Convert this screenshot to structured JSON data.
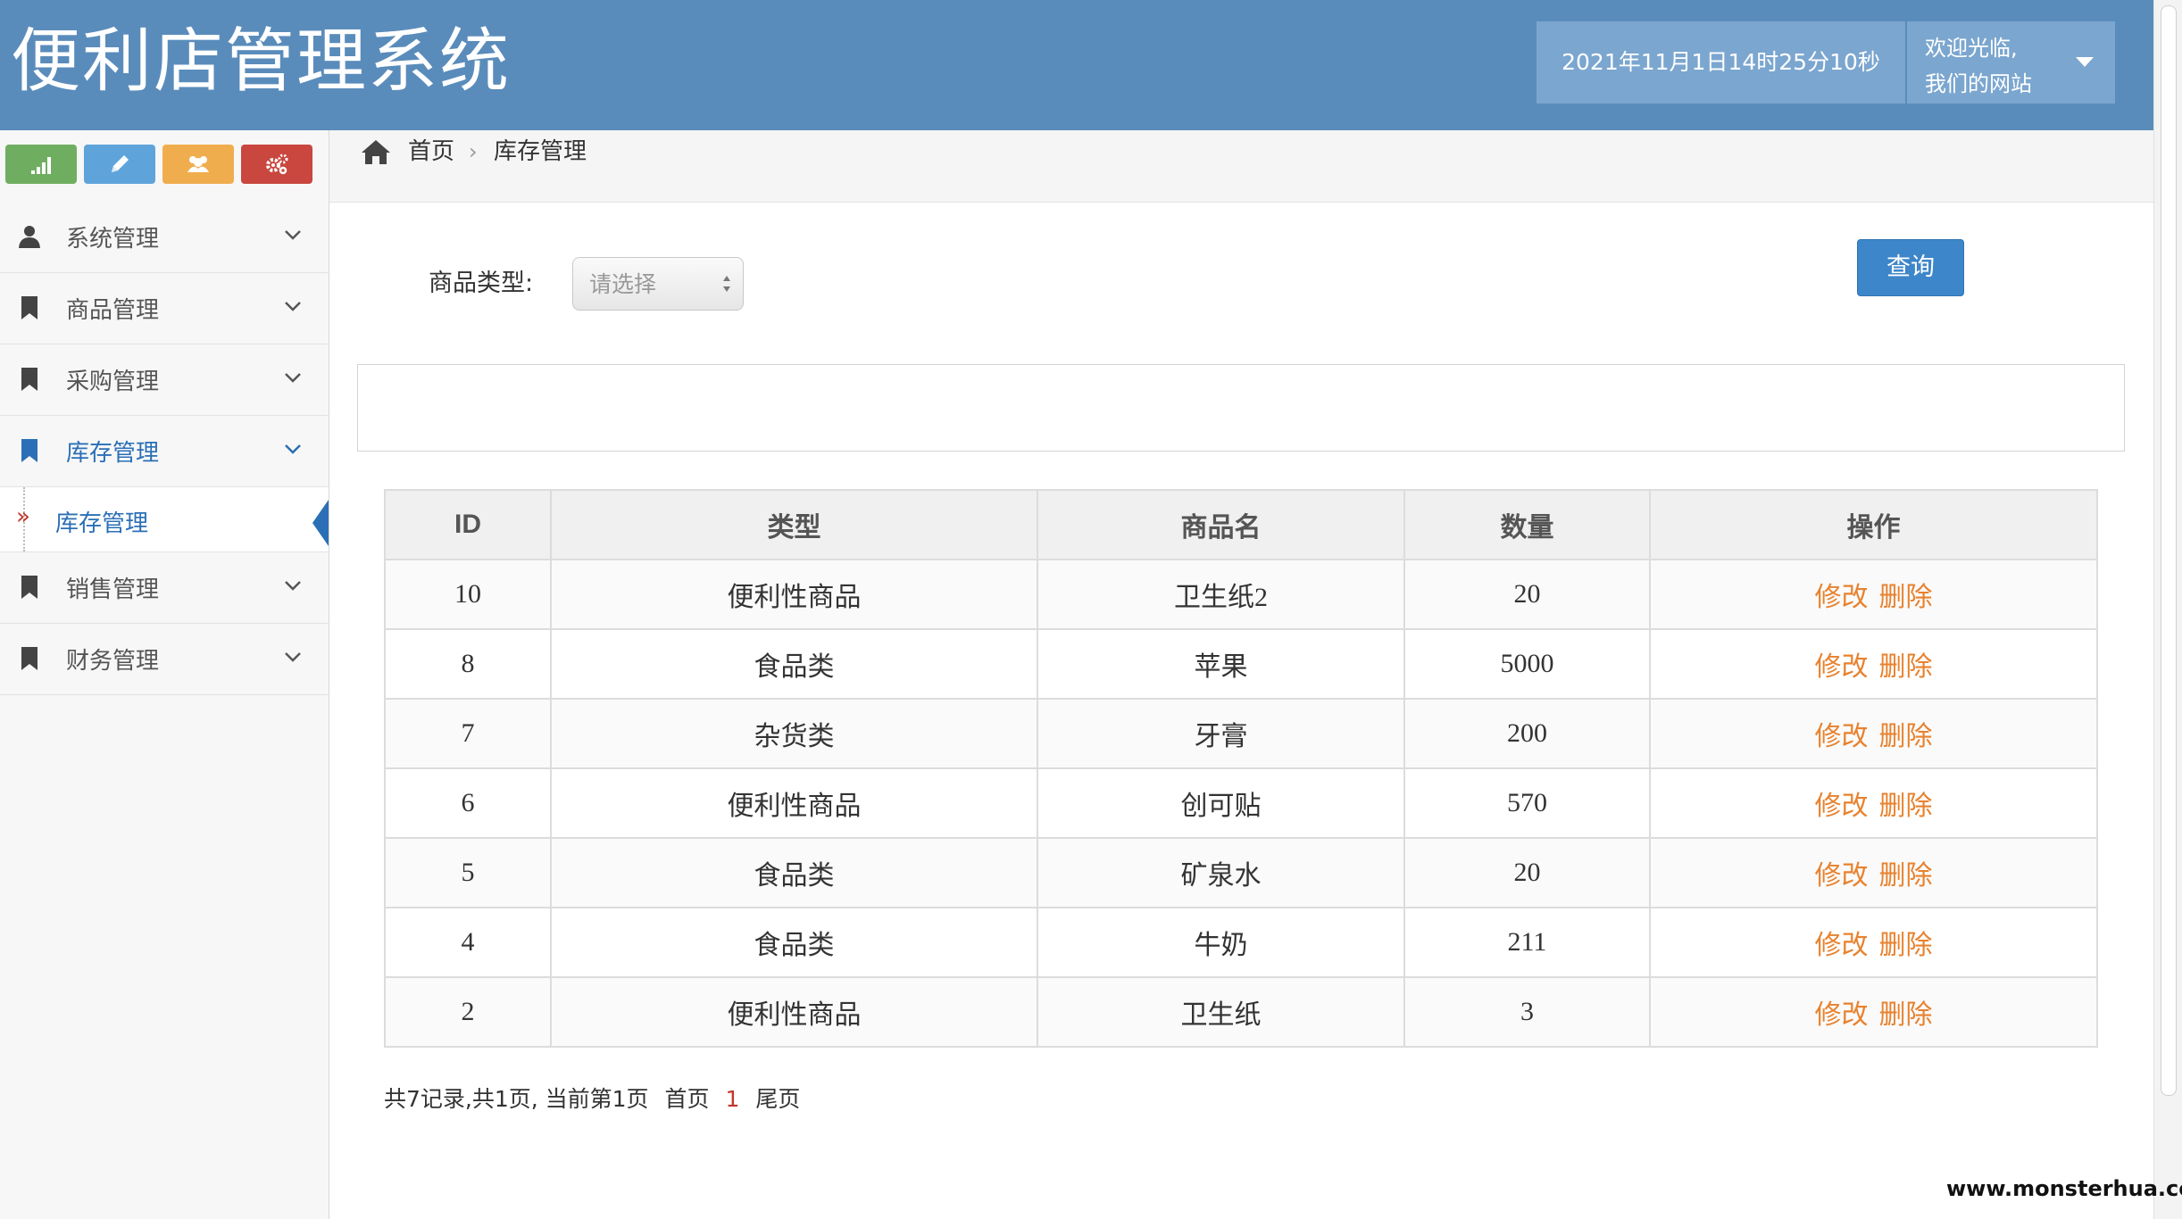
{
  "app": {
    "title": "便利店管理系统"
  },
  "header": {
    "datetime": "2021年11月1日14时25分10秒",
    "welcome_line1": "欢迎光临,",
    "welcome_line2": "我们的网站"
  },
  "shortcuts": [
    {
      "icon": "signal-icon",
      "color": "#6fae60"
    },
    {
      "icon": "pencil-icon",
      "color": "#5ea4db"
    },
    {
      "icon": "users-icon",
      "color": "#f0ad4e"
    },
    {
      "icon": "cogs-icon",
      "color": "#c9473e"
    }
  ],
  "sidebar": {
    "items": [
      {
        "label": "系统管理",
        "icon": "user-icon"
      },
      {
        "label": "商品管理",
        "icon": "bookmark-icon"
      },
      {
        "label": "采购管理",
        "icon": "bookmark-icon"
      },
      {
        "label": "库存管理",
        "icon": "bookmark-icon",
        "active": true
      },
      {
        "label": "销售管理",
        "icon": "bookmark-icon"
      },
      {
        "label": "财务管理",
        "icon": "bookmark-icon"
      }
    ],
    "sub_item": {
      "label": "库存管理",
      "arrow": "»"
    }
  },
  "breadcrumb": {
    "home": "首页",
    "separator": "›",
    "current": "库存管理"
  },
  "filter": {
    "label": "商品类型:",
    "select_placeholder": "请选择",
    "query_button": "查询"
  },
  "table": {
    "headers": [
      "ID",
      "类型",
      "商品名",
      "数量",
      "操作"
    ],
    "rows": [
      {
        "id": "10",
        "type": "便利性商品",
        "name": "卫生纸2",
        "qty": "20"
      },
      {
        "id": "8",
        "type": "食品类",
        "name": "苹果",
        "qty": "5000"
      },
      {
        "id": "7",
        "type": "杂货类",
        "name": "牙膏",
        "qty": "200"
      },
      {
        "id": "6",
        "type": "便利性商品",
        "name": "创可贴",
        "qty": "570"
      },
      {
        "id": "5",
        "type": "食品类",
        "name": "矿泉水",
        "qty": "20"
      },
      {
        "id": "4",
        "type": "食品类",
        "name": "牛奶",
        "qty": "211"
      },
      {
        "id": "2",
        "type": "便利性商品",
        "name": "卫生纸",
        "qty": "3"
      }
    ],
    "edit_label": "修改",
    "delete_label": "删除"
  },
  "pagination": {
    "summary": "共7记录,共1页, 当前第1页",
    "first": "首页",
    "current_page": "1",
    "last": "尾页"
  },
  "watermark": "www.monsterhua.com",
  "colors": {
    "header_bg": "#5a8cbb",
    "accent_blue": "#2b6fb6",
    "op_link": "#e8822e",
    "current_page": "#c0392b"
  }
}
